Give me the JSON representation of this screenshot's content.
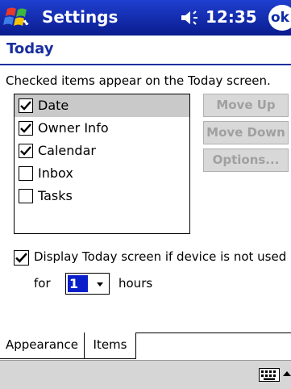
{
  "titlebar": {
    "app_title": "Settings",
    "time": "12:35",
    "ok_label": "ok"
  },
  "page": {
    "title": "Today"
  },
  "instructions": "Checked items appear on the Today screen.",
  "items": [
    {
      "label": "Date",
      "checked": true,
      "selected": true
    },
    {
      "label": "Owner Info",
      "checked": true,
      "selected": false
    },
    {
      "label": "Calendar",
      "checked": true,
      "selected": false
    },
    {
      "label": "Inbox",
      "checked": false,
      "selected": false
    },
    {
      "label": "Tasks",
      "checked": false,
      "selected": false
    }
  ],
  "buttons": {
    "move_up": "Move Up",
    "move_down": "Move Down",
    "options": "Options..."
  },
  "display": {
    "label": "Display Today screen if device is not used",
    "checked": true,
    "for_label": "for",
    "hours_value": "1",
    "hours_label": "hours"
  },
  "tabs": {
    "appearance": "Appearance",
    "items": "Items"
  },
  "colors": {
    "titlebar": "#0d2aa8",
    "accent": "#1a2f9e",
    "selection": "#c9c9c9"
  }
}
